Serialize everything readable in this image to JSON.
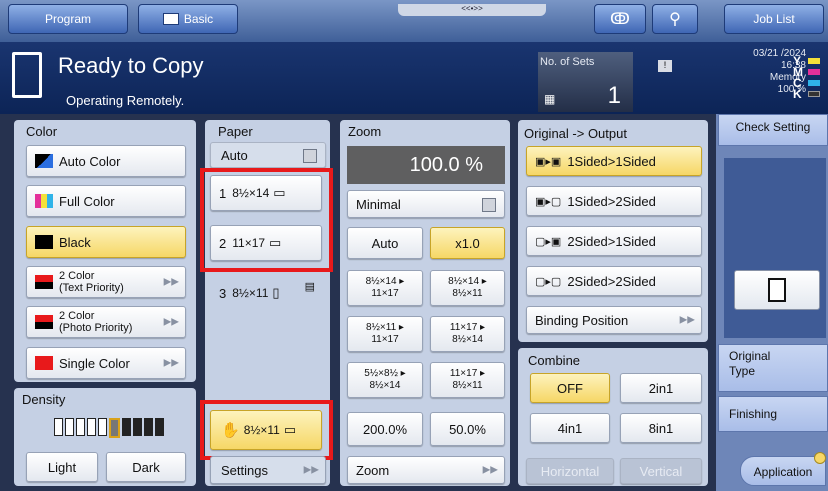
{
  "topbar": {
    "program_label": "Program",
    "basic_label": "Basic",
    "center_tab": "<<•>>",
    "job_list_label": "Job List"
  },
  "status": {
    "title": "Ready to Copy",
    "subtitle": "Operating Remotely.",
    "sets_label": "No. of Sets",
    "sets_value": "1",
    "date": "03/21 /2024",
    "time": "16:38",
    "memory_label": "Memory",
    "memory_value": "100 %",
    "toner": [
      "Y",
      "M",
      "C",
      "K"
    ]
  },
  "color": {
    "title": "Color",
    "options": [
      "Auto Color",
      "Full Color",
      "Black"
    ],
    "two_color_text": [
      "2 Color",
      "(Text Priority)"
    ],
    "two_color_photo": [
      "2 Color",
      "(Photo Priority)"
    ],
    "single_color": "Single Color",
    "selected": "Black"
  },
  "density": {
    "title": "Density",
    "light": "Light",
    "dark": "Dark"
  },
  "paper": {
    "title": "Paper",
    "auto": "Auto",
    "trays": [
      {
        "num": "1",
        "size": "8½×14"
      },
      {
        "num": "2",
        "size": "11×17"
      },
      {
        "num": "3",
        "size": "8½×11"
      }
    ],
    "bypass_size": "8½×11",
    "settings": "Settings"
  },
  "zoom": {
    "title": "Zoom",
    "value": "100.0 %",
    "minimal": "Minimal",
    "auto": "Auto",
    "x1": "x1.0",
    "presets": [
      [
        "8½×14 ▸",
        "11×17"
      ],
      [
        "8½×14 ▸",
        "8½×11"
      ],
      [
        "8½×11 ▸",
        "11×17"
      ],
      [
        "11×17 ▸",
        "8½×14"
      ],
      [
        "5½×8½ ▸",
        "8½×14"
      ],
      [
        "11×17 ▸",
        "8½×11"
      ]
    ],
    "p200": "200.0%",
    "p50": "50.0%",
    "zoom_btn": "Zoom"
  },
  "original_output": {
    "title": "Original -> Output",
    "options": [
      "1Sided>1Sided",
      "1Sided>2Sided",
      "2Sided>1Sided",
      "2Sided>2Sided"
    ],
    "binding": "Binding Position"
  },
  "combine": {
    "title": "Combine",
    "off": "OFF",
    "two": "2in1",
    "four": "4in1",
    "eight": "8in1",
    "horizontal": "Horizontal",
    "vertical": "Vertical"
  },
  "right": {
    "check_setting": "Check Setting",
    "original_type": [
      "Original",
      "Type"
    ],
    "finishing": "Finishing",
    "application": "Application"
  },
  "colors": {
    "highlight": "#e8191b",
    "selected": "#f6d766"
  }
}
